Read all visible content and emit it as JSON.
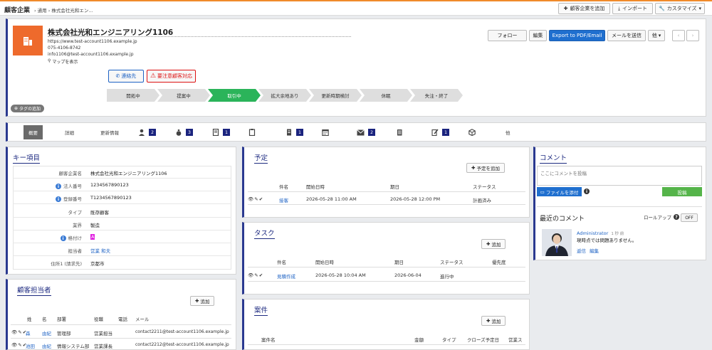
{
  "breadcrumb": {
    "root": "顧客企業",
    "path": "› 通用 › 株式会社光和エン..."
  },
  "toolbar": {
    "add_label": "顧客企業を追加",
    "import_label": "インポート",
    "customize_label": "カスタマイズ"
  },
  "company": {
    "name": "株式会社光和エンジニアリング1106",
    "url": "https://www.test-account1106.example.jp",
    "phone": "075-4106-8742",
    "email": "info1106@test-account1106.example.jp",
    "map_label": "マップを表示",
    "contact_btn": "連絡先",
    "bad_customer_btn": "要注意顧客対応"
  },
  "actions": {
    "follow": "フォロー",
    "edit": "編集",
    "export": "Export to PDF/Email",
    "send_mail": "メールを送信",
    "other": "他"
  },
  "stages": [
    "開拓中",
    "提案中",
    "取引中",
    "拡大余地あり",
    "更新時期検討",
    "休眠",
    "失注・終了"
  ],
  "active_stage": 2,
  "tag_label": "タグの追加",
  "tabs": [
    {
      "label": "概要",
      "badge": ""
    },
    {
      "label": "詳細",
      "badge": ""
    },
    {
      "label": "更新情報",
      "badge": ""
    },
    {
      "label": "",
      "badge": "2"
    },
    {
      "label": "",
      "badge": "3"
    },
    {
      "label": "",
      "badge": "1"
    },
    {
      "label": "",
      "badge": ""
    },
    {
      "label": "",
      "badge": "1"
    },
    {
      "label": "",
      "badge": ""
    },
    {
      "label": "",
      "badge": "2"
    },
    {
      "label": "",
      "badge": ""
    },
    {
      "label": "",
      "badge": "1"
    },
    {
      "label": "",
      "badge": ""
    },
    {
      "label": "他",
      "badge": ""
    }
  ],
  "key_items": {
    "title": "キー項目",
    "rows": [
      {
        "label": "顧客企業名",
        "value": "株式会社光和エンジニアリング1106",
        "info": false
      },
      {
        "label": "法人番号",
        "value": "1234567890123",
        "info": true
      },
      {
        "label": "登録番号",
        "value": "T1234567890123",
        "info": true
      },
      {
        "label": "タイプ",
        "value": "既存顧客",
        "info": false
      },
      {
        "label": "業界",
        "value": "製造",
        "info": false
      },
      {
        "label": "格付け",
        "value": "A",
        "info": true
      },
      {
        "label": "担当者",
        "value": "営業 和夫",
        "info": false
      },
      {
        "label": "住所1 (請求先)",
        "value": "京都市",
        "info": false
      }
    ]
  },
  "contacts": {
    "title": "顧客担当者",
    "add_label": "追加",
    "headers": [
      "姓",
      "名",
      "部署",
      "役職",
      "電話",
      "メール"
    ],
    "rows": [
      {
        "last": "森",
        "first": "由紀",
        "dept": "管理部",
        "title": "営業担当",
        "phone": "",
        "email": "contact2211@test-account1106.example.jp"
      },
      {
        "last": "池田",
        "first": "由紀",
        "dept": "情報システム部",
        "title": "営業課長",
        "phone": "",
        "email": "contact2212@test-account1106.example.jp"
      }
    ]
  },
  "schedule": {
    "title": "予定",
    "add_label": "予定を追加",
    "headers": [
      "件名",
      "開始日時",
      "期日",
      "ステータス"
    ],
    "rows": [
      {
        "subject": "接客",
        "start": "2026-05-28 11:00 AM",
        "due": "2026-05-28 12:00 PM",
        "status": "計画済み"
      }
    ]
  },
  "tasks": {
    "title": "タスク",
    "add_label": "追加",
    "headers": [
      "件名",
      "開始日時",
      "期日",
      "ステータス",
      "優先度"
    ],
    "rows": [
      {
        "subject": "見積作成",
        "start": "2026-05-28 10:04 AM",
        "due": "2026-06-04",
        "status": "進行中",
        "priority": ""
      }
    ]
  },
  "deals": {
    "title": "案件",
    "add_label": "追加",
    "headers": [
      "案件名",
      "金額",
      "タイプ",
      "クローズ予定日",
      "営業ス"
    ]
  },
  "comments": {
    "title": "コメント",
    "placeholder": "ここにコメントを投稿",
    "attach_label": "ファイルを添付",
    "post_label": "投稿",
    "recent_title": "最近のコメント",
    "rollup_label": "ロールアップ",
    "toggle_label": "OFF",
    "author": "Administrator",
    "time": "1 秒 前",
    "text": "現時点では問題ありません。",
    "reply": "返信",
    "edit": "編集"
  },
  "colors": {
    "accent": "#2a3990",
    "primary": "#1f6fcf",
    "active_stage": "#2bb45a",
    "logo": "#ee6a2c",
    "post": "#55b44a"
  }
}
